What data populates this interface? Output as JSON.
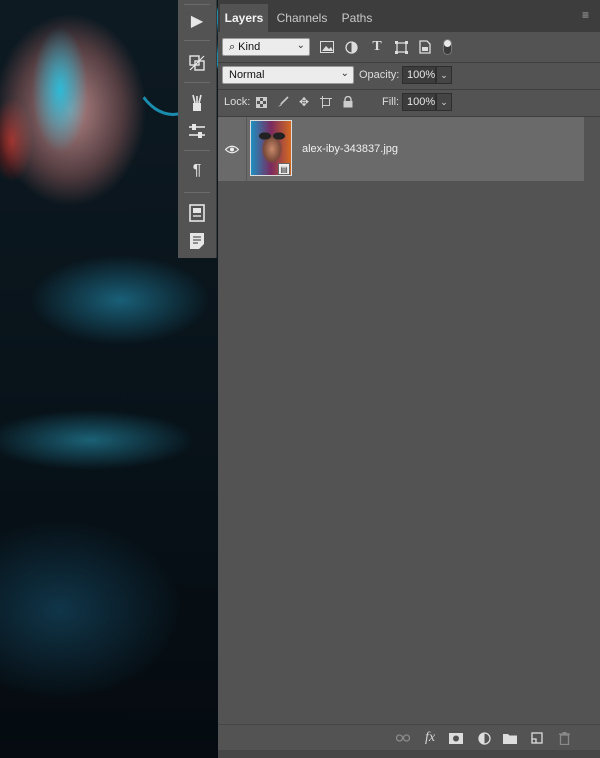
{
  "tabs": [
    {
      "label": "Layers",
      "active": true
    },
    {
      "label": "Channels",
      "active": false
    },
    {
      "label": "Paths",
      "active": false
    }
  ],
  "filter": {
    "kind_label": "Kind"
  },
  "blend": {
    "mode": "Normal",
    "opacity_label": "Opacity:",
    "opacity_value": "100%"
  },
  "lock": {
    "label": "Lock:",
    "fill_label": "Fill:",
    "fill_value": "100%"
  },
  "layers": [
    {
      "name": "alex-iby-343837.jpg",
      "visible": true,
      "type": "smart-object"
    }
  ],
  "tool_icons": [
    "play-icon",
    "transform-icon",
    "brush-settings-icon",
    "adjustments-icon",
    "paragraph-icon",
    "properties-icon",
    "notes-icon"
  ],
  "footer_icons": [
    "link-icon",
    "fx-icon",
    "mask-icon",
    "adjustment-layer-icon",
    "group-folder-icon",
    "new-layer-icon",
    "trash-icon"
  ],
  "colors": {
    "panel_bg": "#535353",
    "tab_bar_bg": "#3d3d3d",
    "selected_layer_bg": "#6a6a6a"
  }
}
